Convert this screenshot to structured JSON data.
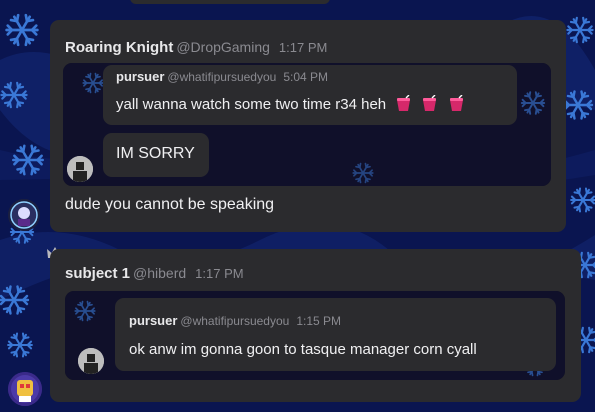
{
  "colors": {
    "background": "#0a1550",
    "snowflake": "#3a78d6",
    "card": "#2b2b2e",
    "embed": "#151519",
    "name": "#e8e8ea",
    "meta": "#8a8a90",
    "cup": "#d6286a"
  },
  "messages": [
    {
      "author": "Roaring Knight",
      "handle": "@DropGaming",
      "time": "1:17 PM",
      "quoted": {
        "author": "pursuer",
        "handle": "@whatifipursuedyou",
        "time": "5:04 PM",
        "lines": [
          {
            "text": "yall wanna watch some two time r34 heh",
            "emoji": [
              "cup-with-straw-icon",
              "cup-with-straw-icon",
              "cup-with-straw-icon"
            ]
          },
          {
            "text": "IM SORRY"
          }
        ]
      },
      "text": "dude you cannot be speaking"
    },
    {
      "author": "subject 1",
      "handle": "@hiberd",
      "time": "1:17 PM",
      "quoted": {
        "author": "pursuer",
        "handle": "@whatifipursuedyou",
        "time": "1:15 PM",
        "lines": [
          {
            "text": "ok anw im gonna goon to tasque manager corn cyall"
          }
        ]
      }
    }
  ]
}
